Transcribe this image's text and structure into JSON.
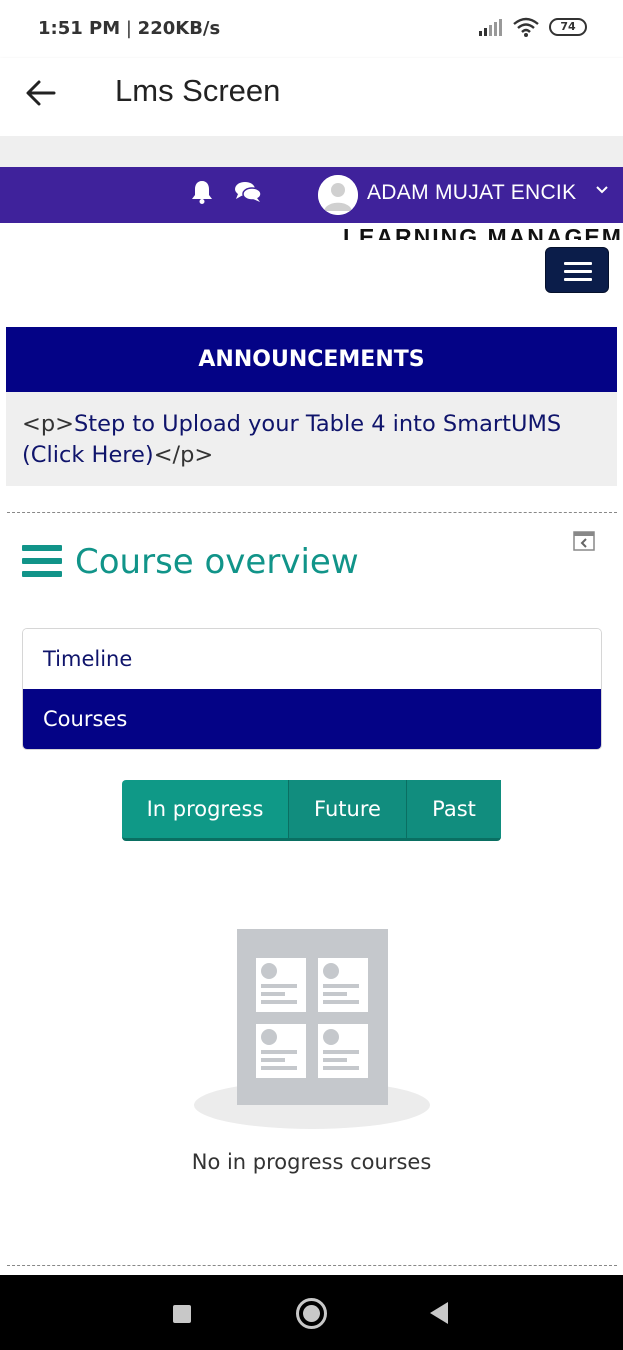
{
  "status_bar": {
    "time": "1:51 PM",
    "separator": " | ",
    "net_speed": "220KB/s",
    "battery": "74",
    "icons": [
      "signal-icon",
      "wifi-icon",
      "battery-icon"
    ]
  },
  "app_bar": {
    "back_icon": "arrow-left-icon",
    "title": "Lms Screen"
  },
  "top_nav": {
    "background": "#3f229b",
    "icons": [
      "bell-icon",
      "chat-icon",
      "avatar",
      "chevron-down-icon"
    ],
    "user_name": "ADAM MUJAT ENCIK"
  },
  "site": {
    "title": "LEARNING MANAGEMENT S",
    "menu_icon": "hamburger-menu-icon"
  },
  "announcements": {
    "header": "ANNOUNCEMENTS",
    "tag_open": "<p>",
    "text": "Step to Upload your Table 4 into SmartUMS (Click Here)",
    "tag_close": "</p>",
    "header_color": "#040386"
  },
  "course_overview": {
    "title": "Course overview",
    "collapse_icon": "collapse-block-icon",
    "tabs": [
      {
        "label": "Timeline",
        "active": false
      },
      {
        "label": "Courses",
        "active": true
      }
    ],
    "filters": [
      {
        "label": "In progress",
        "active": true
      },
      {
        "label": "Future",
        "active": false
      },
      {
        "label": "Past",
        "active": false
      }
    ],
    "empty_message": "No in progress courses",
    "accent": "#119489"
  },
  "system_nav": {
    "buttons": [
      "recents-square-icon",
      "home-circle-icon",
      "back-triangle-icon"
    ]
  }
}
